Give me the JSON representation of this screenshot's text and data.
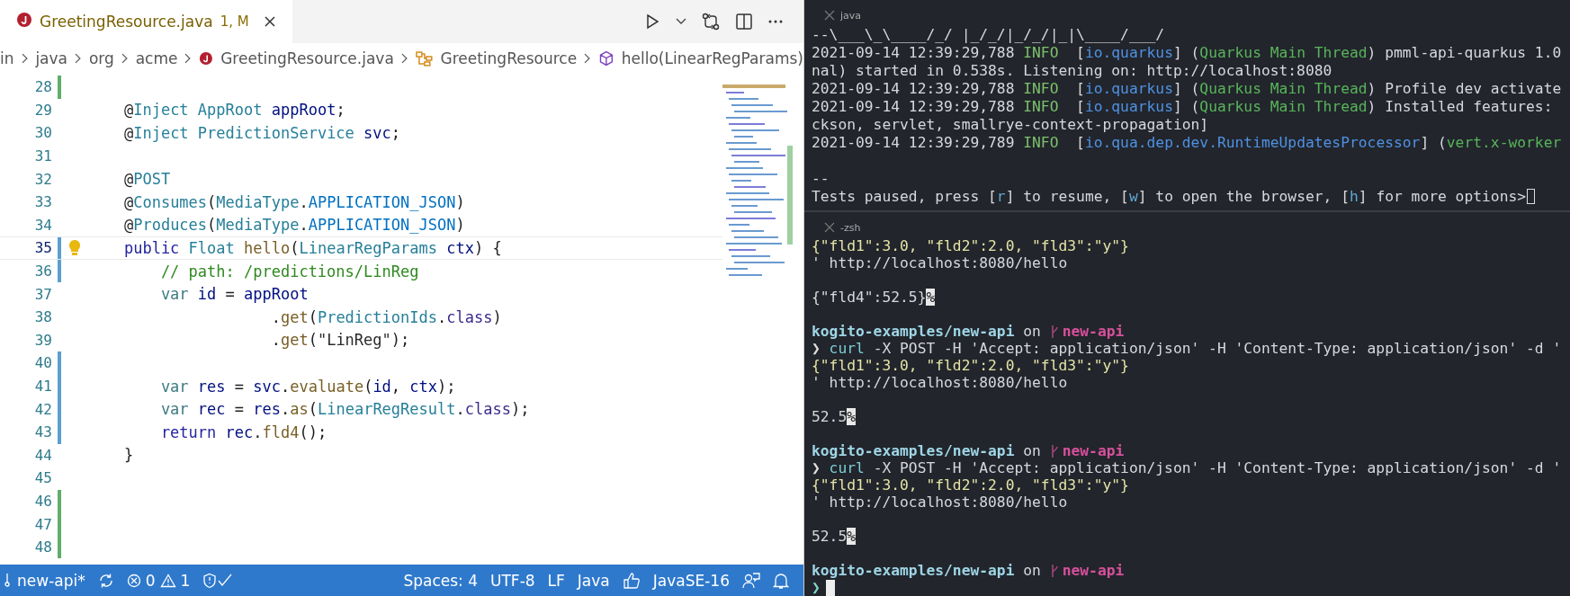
{
  "editor": {
    "tabs": [
      {
        "title": "GreetingResource.java",
        "badge": "1, M",
        "selected": true
      }
    ],
    "breadcrumbs": [
      {
        "text": "in",
        "kind": "folder"
      },
      {
        "text": "java",
        "kind": "folder"
      },
      {
        "text": "org",
        "kind": "folder"
      },
      {
        "text": "acme",
        "kind": "folder"
      },
      {
        "text": "GreetingResource.java",
        "kind": "file"
      },
      {
        "text": "GreetingResource",
        "kind": "class"
      },
      {
        "text": "hello(LinearRegParams)",
        "kind": "method"
      }
    ],
    "lines": [
      {
        "number": "28",
        "color": "#5fae6a",
        "current": false,
        "hint": false
      },
      {
        "number": "29",
        "current": false,
        "hint": false,
        "tokens": [
          {
            "text": "    @",
            "kind": "p"
          },
          {
            "text": "Inject ",
            "kind": "t"
          },
          {
            "text": "AppRoot ",
            "kind": "t"
          },
          {
            "text": "appRoot",
            "kind": "v"
          },
          {
            "text": ";",
            "kind": "p"
          }
        ]
      },
      {
        "number": "30",
        "current": false,
        "hint": false,
        "tokens": [
          {
            "text": "    @",
            "kind": "p"
          },
          {
            "text": "Inject ",
            "kind": "t"
          },
          {
            "text": "PredictionService ",
            "kind": "t"
          },
          {
            "text": "svc",
            "kind": "v"
          },
          {
            "text": ";",
            "kind": "p"
          }
        ]
      },
      {
        "number": "31",
        "current": false,
        "hint": false
      },
      {
        "number": "32",
        "current": false,
        "hint": false,
        "tokens": [
          {
            "text": "    @",
            "kind": "p"
          },
          {
            "text": "POST",
            "kind": "t"
          }
        ]
      },
      {
        "number": "33",
        "current": false,
        "hint": false,
        "tokens": [
          {
            "text": "    @",
            "kind": "p"
          },
          {
            "text": "Consumes",
            "kind": "t"
          },
          {
            "text": "(",
            "kind": "p"
          },
          {
            "text": "MediaType",
            "kind": "t"
          },
          {
            "text": ".",
            "kind": "p"
          },
          {
            "text": "APPLICATION_JSON",
            "kind": "c"
          },
          {
            "text": ")",
            "kind": "p"
          }
        ]
      },
      {
        "number": "34",
        "current": false,
        "hint": false,
        "tokens": [
          {
            "text": "    @",
            "kind": "p"
          },
          {
            "text": "Produces",
            "kind": "t"
          },
          {
            "text": "(",
            "kind": "p"
          },
          {
            "text": "MediaType",
            "kind": "t"
          },
          {
            "text": ".",
            "kind": "p"
          },
          {
            "text": "APPLICATION_JSON",
            "kind": "c"
          },
          {
            "text": ")",
            "kind": "p"
          }
        ]
      },
      {
        "number": "35",
        "color": "#5a9fd0",
        "current": true,
        "hint": true,
        "tokens": [
          {
            "text": "    public ",
            "kind": "k"
          },
          {
            "text": "Float ",
            "kind": "t"
          },
          {
            "text": "hello",
            "kind": "m"
          },
          {
            "text": "(",
            "kind": "p"
          },
          {
            "text": "LinearRegParams ",
            "kind": "t"
          },
          {
            "text": "ctx",
            "kind": "v"
          },
          {
            "text": ") {",
            "kind": "p"
          }
        ]
      },
      {
        "number": "36",
        "color": "#5a9fd0",
        "current": false,
        "hint": false,
        "tokens": [
          {
            "text": "        // path: /predictions/LinReg",
            "kind": "cm"
          }
        ]
      },
      {
        "number": "37",
        "current": false,
        "hint": false,
        "tokens": [
          {
            "text": "        var ",
            "kind": "vk"
          },
          {
            "text": "id",
            "kind": "v"
          },
          {
            "text": " = ",
            "kind": "p"
          },
          {
            "text": "appRoot",
            "kind": "v"
          }
        ]
      },
      {
        "number": "38",
        "current": false,
        "hint": false,
        "tokens": [
          {
            "text": "                    .",
            "kind": "p"
          },
          {
            "text": "get",
            "kind": "m"
          },
          {
            "text": "(",
            "kind": "p"
          },
          {
            "text": "PredictionIds",
            "kind": "t"
          },
          {
            "text": ".",
            "kind": "p"
          },
          {
            "text": "class",
            "kind": "cls"
          },
          {
            "text": ")",
            "kind": "p"
          }
        ]
      },
      {
        "number": "39",
        "current": false,
        "hint": false,
        "tokens": [
          {
            "text": "                    .",
            "kind": "p"
          },
          {
            "text": "get",
            "kind": "m"
          },
          {
            "text": "(",
            "kind": "p"
          },
          {
            "text": "\"LinReg\"",
            "kind": "s"
          },
          {
            "text": ");",
            "kind": "p"
          }
        ]
      },
      {
        "number": "40",
        "color": "#5a9fd0",
        "current": false,
        "hint": false
      },
      {
        "number": "41",
        "color": "#5a9fd0",
        "current": false,
        "hint": false,
        "tokens": [
          {
            "text": "        var ",
            "kind": "vk"
          },
          {
            "text": "res",
            "kind": "v"
          },
          {
            "text": " = ",
            "kind": "p"
          },
          {
            "text": "svc",
            "kind": "v"
          },
          {
            "text": ".",
            "kind": "p"
          },
          {
            "text": "evaluate",
            "kind": "m"
          },
          {
            "text": "(",
            "kind": "p"
          },
          {
            "text": "id",
            "kind": "v"
          },
          {
            "text": ", ",
            "kind": "p"
          },
          {
            "text": "ctx",
            "kind": "v"
          },
          {
            "text": ");",
            "kind": "p"
          }
        ]
      },
      {
        "number": "42",
        "color": "#5a9fd0",
        "current": false,
        "hint": false,
        "tokens": [
          {
            "text": "        var ",
            "kind": "vk"
          },
          {
            "text": "rec",
            "kind": "v"
          },
          {
            "text": " = ",
            "kind": "p"
          },
          {
            "text": "res",
            "kind": "v"
          },
          {
            "text": ".",
            "kind": "p"
          },
          {
            "text": "as",
            "kind": "m"
          },
          {
            "text": "(",
            "kind": "p"
          },
          {
            "text": "LinearRegResult",
            "kind": "t"
          },
          {
            "text": ".",
            "kind": "p"
          },
          {
            "text": "class",
            "kind": "cls"
          },
          {
            "text": ");",
            "kind": "p"
          }
        ]
      },
      {
        "number": "43",
        "color": "#5a9fd0",
        "current": false,
        "hint": false,
        "tokens": [
          {
            "text": "        return ",
            "kind": "k"
          },
          {
            "text": "rec",
            "kind": "v"
          },
          {
            "text": ".",
            "kind": "p"
          },
          {
            "text": "fld4",
            "kind": "m"
          },
          {
            "text": "();",
            "kind": "p"
          }
        ]
      },
      {
        "number": "44",
        "current": false,
        "hint": false,
        "tokens": [
          {
            "text": "    }",
            "kind": "p"
          }
        ]
      },
      {
        "number": "45",
        "current": false,
        "hint": false
      },
      {
        "number": "46",
        "color": "#5fae6a",
        "current": false,
        "hint": false
      },
      {
        "number": "47",
        "color": "#5fae6a",
        "current": false,
        "hint": false
      },
      {
        "number": "48",
        "color": "#5fae6a",
        "current": false,
        "hint": false
      }
    ]
  },
  "status_bar": {
    "branch": "new-api*",
    "errors": "0",
    "warnings": "1",
    "right": [
      "Spaces: 4",
      "UTF-8",
      "LF",
      "Java",
      "JavaSE-16"
    ]
  },
  "terminal": {
    "panes": [
      {
        "title": "java",
        "lines": [
          {
            "kind": "text",
            "tokens": [
              {
                "text": "--\\___\\_\\____/_/ |_/_/|_/_/|_|\\____/___/",
                "kind": "p"
              }
            ]
          },
          {
            "kind": "text",
            "tokens": [
              {
                "text": "2021-09-14 12:39:29,788 ",
                "kind": "p"
              },
              {
                "text": "INFO",
                "kind": "info"
              },
              {
                "text": "  [",
                "kind": "p"
              },
              {
                "text": "io.quarkus",
                "kind": "logger"
              },
              {
                "text": "] (",
                "kind": "p"
              },
              {
                "text": "Quarkus Main Thread",
                "kind": "thread"
              },
              {
                "text": ") pmml-api-quarkus 1.0",
                "kind": "p"
              }
            ]
          },
          {
            "kind": "text",
            "tokens": [
              {
                "text": "nal) started in 0.538s. Listening on: http://localhost:8080",
                "kind": "p"
              }
            ]
          },
          {
            "kind": "text",
            "tokens": [
              {
                "text": "2021-09-14 12:39:29,788 ",
                "kind": "p"
              },
              {
                "text": "INFO",
                "kind": "info"
              },
              {
                "text": "  [",
                "kind": "p"
              },
              {
                "text": "io.quarkus",
                "kind": "logger"
              },
              {
                "text": "] (",
                "kind": "p"
              },
              {
                "text": "Quarkus Main Thread",
                "kind": "thread"
              },
              {
                "text": ") Profile dev activate",
                "kind": "p"
              }
            ]
          },
          {
            "kind": "text",
            "tokens": [
              {
                "text": "2021-09-14 12:39:29,788 ",
                "kind": "p"
              },
              {
                "text": "INFO",
                "kind": "info"
              },
              {
                "text": "  [",
                "kind": "p"
              },
              {
                "text": "io.quarkus",
                "kind": "logger"
              },
              {
                "text": "] (",
                "kind": "p"
              },
              {
                "text": "Quarkus Main Thread",
                "kind": "thread"
              },
              {
                "text": ") Installed features:",
                "kind": "p"
              }
            ]
          },
          {
            "kind": "text",
            "tokens": [
              {
                "text": "ckson, servlet, smallrye-context-propagation]",
                "kind": "p"
              }
            ]
          },
          {
            "kind": "text",
            "tokens": [
              {
                "text": "2021-09-14 12:39:29,789 ",
                "kind": "p"
              },
              {
                "text": "INFO",
                "kind": "info"
              },
              {
                "text": "  [",
                "kind": "p"
              },
              {
                "text": "io.qua.dep.dev.RuntimeUpdatesProcessor",
                "kind": "logger"
              },
              {
                "text": "] (",
                "kind": "p"
              },
              {
                "text": "vert.x-worker",
                "kind": "thread"
              }
            ]
          },
          {
            "kind": "blank"
          },
          {
            "kind": "text",
            "tokens": [
              {
                "text": "--",
                "kind": "p"
              }
            ]
          },
          {
            "kind": "awaiting-input",
            "tokens": [
              {
                "text": "Tests paused, press [",
                "kind": "p"
              },
              {
                "text": "r",
                "kind": "key"
              },
              {
                "text": "] to resume, [",
                "kind": "p"
              },
              {
                "text": "w",
                "kind": "key"
              },
              {
                "text": "] to open the browser, [",
                "kind": "p"
              },
              {
                "text": "h",
                "kind": "key"
              },
              {
                "text": "] for more options>",
                "kind": "p"
              }
            ]
          }
        ]
      },
      {
        "title": "-zsh",
        "lines": [
          {
            "kind": "text",
            "tokens": [
              {
                "text": "{\"fld1\":3.0, \"fld2\":2.0, \"fld3\":\"y\"}",
                "kind": "json"
              }
            ]
          },
          {
            "kind": "text",
            "tokens": [
              {
                "text": "' http://localhost:8080/hello",
                "kind": "p"
              }
            ]
          },
          {
            "kind": "blank"
          },
          {
            "kind": "text",
            "tokens": [
              {
                "text": "{\"fld4\":52.5}",
                "kind": "p"
              },
              {
                "text": "%",
                "kind": "inverse"
              }
            ]
          },
          {
            "kind": "blank"
          },
          {
            "kind": "text",
            "tokens": [
              {
                "text": "kogito-examples/new-api",
                "kind": "path"
              },
              {
                "text": " on ",
                "kind": "p"
              },
              {
                "text": "new-api",
                "kind": "branch"
              }
            ]
          },
          {
            "kind": "text",
            "tokens": [
              {
                "text": "❯ ",
                "kind": "prompt"
              },
              {
                "text": "curl",
                "kind": "cmd"
              },
              {
                "text": " -X POST -H 'Accept: application/json' -H 'Content-Type: application/json' -d '",
                "kind": "p"
              }
            ]
          },
          {
            "kind": "text",
            "tokens": [
              {
                "text": "{\"fld1\":3.0, \"fld2\":2.0, \"fld3\":\"y\"}",
                "kind": "json"
              }
            ]
          },
          {
            "kind": "text",
            "tokens": [
              {
                "text": "' http://localhost:8080/hello",
                "kind": "p"
              }
            ]
          },
          {
            "kind": "blank"
          },
          {
            "kind": "text",
            "tokens": [
              {
                "text": "52.5",
                "kind": "p"
              },
              {
                "text": "%",
                "kind": "inverse"
              }
            ]
          },
          {
            "kind": "blank"
          },
          {
            "kind": "text",
            "tokens": [
              {
                "text": "kogito-examples/new-api",
                "kind": "path"
              },
              {
                "text": " on ",
                "kind": "p"
              },
              {
                "text": "new-api",
                "kind": "branch"
              }
            ]
          },
          {
            "kind": "text",
            "tokens": [
              {
                "text": "❯ ",
                "kind": "prompt"
              },
              {
                "text": "curl",
                "kind": "cmd"
              },
              {
                "text": " -X POST -H 'Accept: application/json' -H 'Content-Type: application/json' -d '",
                "kind": "p"
              }
            ]
          },
          {
            "kind": "text",
            "tokens": [
              {
                "text": "{\"fld1\":3.0, \"fld2\":2.0, \"fld3\":\"y\"}",
                "kind": "json"
              }
            ]
          },
          {
            "kind": "text",
            "tokens": [
              {
                "text": "' http://localhost:8080/hello",
                "kind": "p"
              }
            ]
          },
          {
            "kind": "blank"
          },
          {
            "kind": "text",
            "tokens": [
              {
                "text": "52.5",
                "kind": "p"
              },
              {
                "text": "%",
                "kind": "inverse"
              }
            ]
          },
          {
            "kind": "blank"
          },
          {
            "kind": "text",
            "tokens": [
              {
                "text": "kogito-examples/new-api",
                "kind": "path"
              },
              {
                "text": " on ",
                "kind": "p"
              },
              {
                "text": "new-api",
                "kind": "branch"
              }
            ]
          },
          {
            "kind": "prompt",
            "tokens": [
              {
                "text": "❯",
                "kind": "prompt-active"
              }
            ]
          }
        ]
      }
    ]
  }
}
